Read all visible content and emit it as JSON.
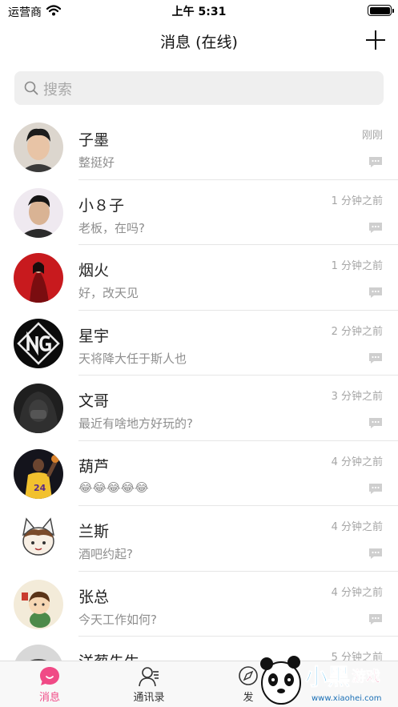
{
  "status_bar": {
    "carrier": "运营商",
    "time": "上午 5:31",
    "battery_level": 1.0
  },
  "nav": {
    "title": "消息 (在线)"
  },
  "search": {
    "placeholder": "搜索"
  },
  "conversations": [
    {
      "name": "子墨",
      "message": "整挺好",
      "time": "刚刚"
    },
    {
      "name": "小８子",
      "message": "老板，在吗?",
      "time": "1 分钟之前"
    },
    {
      "name": "烟火",
      "message": "好，改天见",
      "time": "1 分钟之前"
    },
    {
      "name": "星宇",
      "message": "天将降大任于斯人也",
      "time": "2 分钟之前"
    },
    {
      "name": "文哥",
      "message": "最近有啥地方好玩的?",
      "time": "3 分钟之前"
    },
    {
      "name": "葫芦",
      "message": "😂😂😂😂😂",
      "time": "4 分钟之前"
    },
    {
      "name": "兰斯",
      "message": "酒吧约起?",
      "time": "4 分钟之前"
    },
    {
      "name": "张总",
      "message": "今天工作如何?",
      "time": "4 分钟之前"
    },
    {
      "name": "洋葱先生",
      "message": "",
      "time": "5 分钟之前"
    }
  ],
  "tabs": [
    {
      "label": "消息",
      "icon": "chat-bubble-icon",
      "active": true
    },
    {
      "label": "通讯录",
      "icon": "contacts-icon",
      "active": false
    },
    {
      "label": "发",
      "icon": "discover-icon",
      "active": false
    }
  ],
  "watermark": {
    "text": "小黑游戏",
    "url": "www.xiaohei.com"
  },
  "colors": {
    "accent": "#f04a86",
    "divider": "#e6e6e6",
    "secondary_text": "#8e8e8e"
  }
}
